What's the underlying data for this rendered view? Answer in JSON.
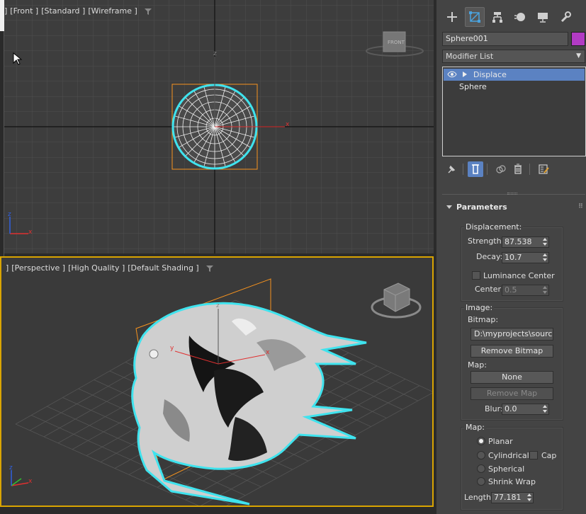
{
  "viewport_front": {
    "labels": [
      "]",
      "[Front ]",
      "[Standard ]",
      "[Wireframe ]"
    ],
    "viewcube_label": "FRONT"
  },
  "viewport_persp": {
    "labels": [
      "]",
      "[Perspective ]",
      "[High Quality ]",
      "[Default Shading ]"
    ]
  },
  "axis_labels": {
    "x": "x",
    "y": "y",
    "z": "z"
  },
  "panel": {
    "tabs": [
      "create-icon",
      "modify-icon",
      "hierarchy-icon",
      "motion-icon",
      "display-icon",
      "utilities-icon"
    ],
    "object_name": "Sphere001",
    "object_color": "#b23bc4",
    "modifier_list": "Modifier List",
    "stack": [
      {
        "label": "Displace",
        "selected": true
      },
      {
        "label": "Sphere",
        "selected": false
      }
    ],
    "rollout_title": "Parameters",
    "displacement": {
      "group_label": "Displacement:",
      "strength_label": "Strength:",
      "strength_value": "87.538",
      "decay_label": "Decay:",
      "decay_value": "10.7",
      "luminance_label": "Luminance Center",
      "center_label": "Center:",
      "center_value": "0.5"
    },
    "image": {
      "group_label": "Image:",
      "bitmap_label": "Bitmap:",
      "bitmap_path": "D:\\myprojects\\source\\images",
      "remove_bitmap": "Remove Bitmap",
      "map_label": "Map:",
      "map_button": "None",
      "remove_map": "Remove Map",
      "blur_label": "Blur:",
      "blur_value": "0.0"
    },
    "map": {
      "group_label": "Map:",
      "options": [
        "Planar",
        "Cylindrical",
        "Spherical",
        "Shrink Wrap"
      ],
      "selected": "Planar",
      "cap_label": "Cap",
      "length_label": "Length:",
      "length_value": "77.181"
    }
  },
  "colors": {
    "selection_outline": "#3fe3ee",
    "bounding_box": "#f7931e",
    "active_viewport_border": "#d9a400",
    "stack_selected": "#5b82c2"
  }
}
